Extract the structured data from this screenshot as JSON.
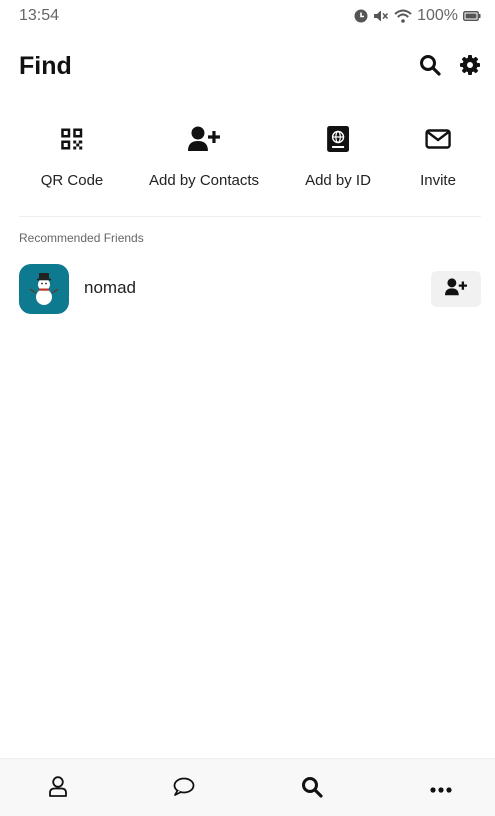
{
  "status_bar": {
    "time": "13:54",
    "battery": "100%",
    "icons": [
      "alarm-icon",
      "mute-icon",
      "wifi-icon",
      "battery-icon"
    ]
  },
  "header": {
    "title": "Find",
    "icons": [
      "search-icon",
      "gear-icon"
    ]
  },
  "actions": [
    {
      "label": "QR Code",
      "icon": "qr-code-icon"
    },
    {
      "label": "Add by Contacts",
      "icon": "user-plus-icon"
    },
    {
      "label": "Add by ID",
      "icon": "id-book-icon"
    },
    {
      "label": "Invite",
      "icon": "envelope-icon"
    }
  ],
  "recommended": {
    "label": "Recommended Friends",
    "friends": [
      {
        "name": "nomad",
        "avatar": "snowman-avatar",
        "action_icon": "user-plus-icon"
      }
    ]
  },
  "bottom_nav": {
    "items": [
      "profile-icon",
      "chat-icon",
      "search-icon",
      "more-icon"
    ],
    "active": "search-icon"
  },
  "colors": {
    "avatar_bg": "#0e7a8f",
    "text": "#111111",
    "muted": "#666666",
    "nav_bg": "#f8f8f8"
  }
}
